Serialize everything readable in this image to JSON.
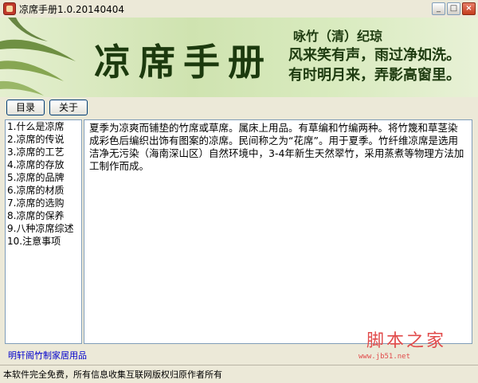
{
  "window": {
    "title": "凉席手册1.0.20140404",
    "buttons": {
      "minimize": "_",
      "maximize": "□",
      "close": "×"
    }
  },
  "banner": {
    "title": "凉席手册",
    "poem_line1": "咏竹（清）纪琼",
    "poem_line2": "风来笑有声，雨过净如洗。",
    "poem_line3": "有时明月来，弄影高窗里。"
  },
  "toolbar": {
    "contents_label": "目录",
    "about_label": "关于"
  },
  "toc": {
    "items": [
      "1.什么是凉席",
      "2.凉席的传说",
      "3.凉席的工艺",
      "4.凉席的存放",
      "5.凉席的品牌",
      "6.凉席的材质",
      "7.凉席的选购",
      "8.凉席的保养",
      "9.八种凉席综述",
      "10.注意事项"
    ]
  },
  "content": {
    "paragraph1": "夏季为凉爽而铺垫的竹席或草席。属床上用品。有草编和竹编两种。将竹篾和草茎染成彩色后编织出饰有图案的凉席。民间称之为“花席”。用于夏季。竹纤维凉席是选用洁净无污染（海南深山区）自然环境中，3-4年新生天然翠竹，采用蒸煮等物理方法加工制作而成。"
  },
  "footer": {
    "link_text": "明轩阁竹制家居用品",
    "status_text": "本软件完全免费，所有信息收集互联网版权归原作者所有",
    "watermark": "脚本之家",
    "watermark_url": "www.jb51.net"
  },
  "colors": {
    "banner_green": "#cfe3b0",
    "title_dark": "#1c3a0e",
    "link_blue": "#0000cc",
    "watermark_red": "#e14b4b"
  }
}
